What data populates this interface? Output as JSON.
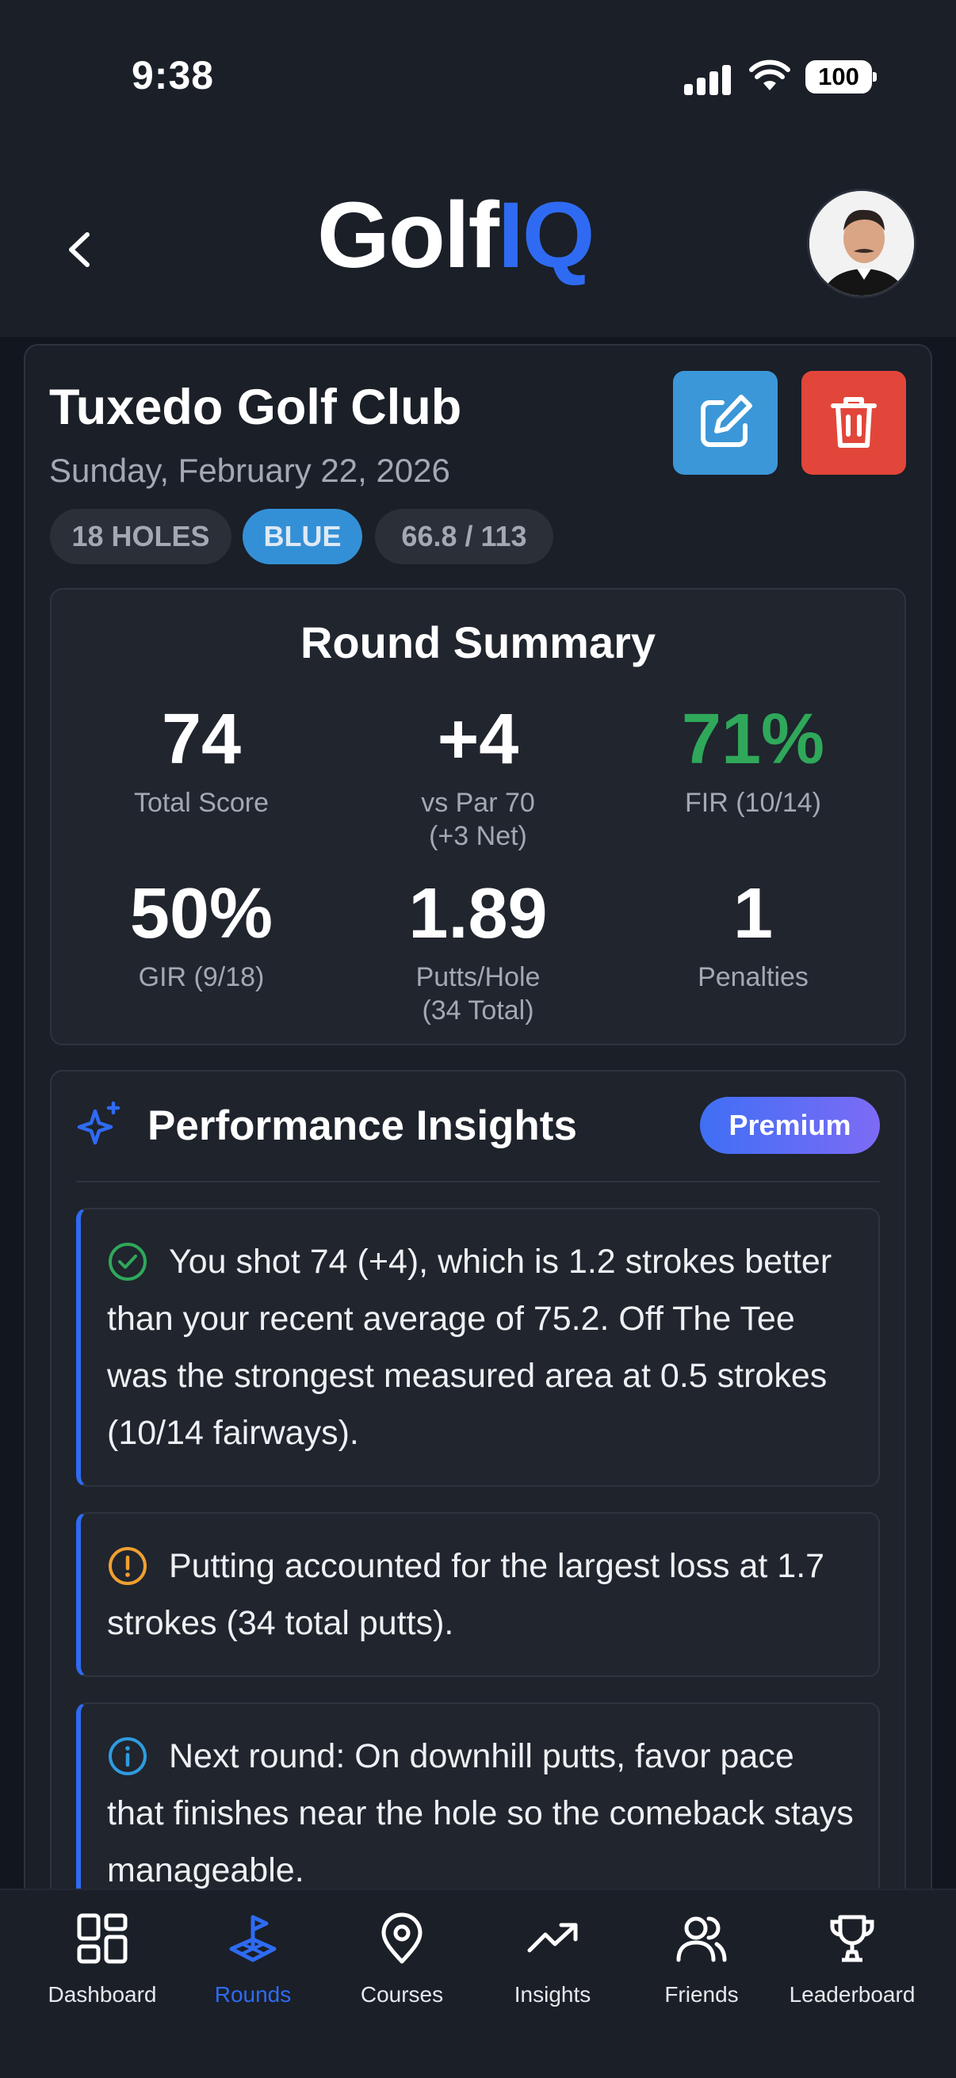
{
  "status": {
    "time": "9:38",
    "battery": "100"
  },
  "header": {
    "logo_a": "Golf",
    "logo_b": "IQ"
  },
  "round": {
    "course": "Tuxedo Golf Club",
    "date": "Sunday, February 22, 2026",
    "chips": [
      "18 HOLES",
      "BLUE",
      "66.8 / 113"
    ]
  },
  "summary": {
    "title": "Round Summary",
    "stats": [
      {
        "value": "74",
        "label": "Total Score",
        "sub": ""
      },
      {
        "value": "+4",
        "label": "vs Par 70",
        "sub": "(+3 Net)"
      },
      {
        "value": "71%",
        "label": "FIR (10/14)",
        "sub": ""
      },
      {
        "value": "50%",
        "label": "GIR (9/18)",
        "sub": ""
      },
      {
        "value": "1.89",
        "label": "Putts/Hole",
        "sub": "(34 Total)"
      },
      {
        "value": "1",
        "label": "Penalties",
        "sub": ""
      }
    ]
  },
  "insights": {
    "title": "Performance Insights",
    "badge": "Premium",
    "items": [
      {
        "icon": "check-circle-icon",
        "text": "You shot 74 (+4), which is 1.2 strokes better than your recent average of 75.2. Off The Tee was the strongest measured area at 0.5 strokes (10/14 fairways)."
      },
      {
        "icon": "alert-circle-icon",
        "text": "Putting accounted for the largest loss at 1.7 strokes (34 total putts)."
      },
      {
        "icon": "info-circle-icon",
        "text": "Next round: On downhill putts, favor pace that finishes near the hole so the comeback stays manageable."
      }
    ]
  },
  "tabs": [
    {
      "label": "Dashboard",
      "icon": "dashboard-icon"
    },
    {
      "label": "Rounds",
      "icon": "rounds-flag-icon",
      "active": true
    },
    {
      "label": "Courses",
      "icon": "map-pin-icon"
    },
    {
      "label": "Insights",
      "icon": "trending-up-icon"
    },
    {
      "label": "Friends",
      "icon": "users-icon"
    },
    {
      "label": "Leaderboard",
      "icon": "trophy-icon"
    }
  ],
  "colors": {
    "accent": "#2f6bf2",
    "good": "#2fa85a",
    "warn": "#f0a030",
    "info": "#2f9be0",
    "edit": "#3b97d8",
    "delete": "#e2463a"
  }
}
